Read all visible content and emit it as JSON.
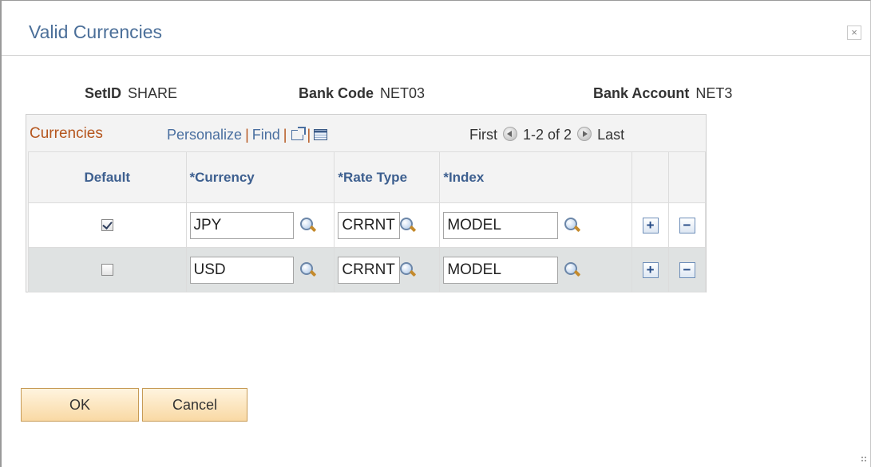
{
  "dialog": {
    "title": "Valid Currencies",
    "close_symbol": "×"
  },
  "header": {
    "setid_label": "SetID",
    "setid_value": "SHARE",
    "bank_code_label": "Bank Code",
    "bank_code_value": "NET03",
    "bank_account_label": "Bank Account",
    "bank_account_value": "NET3"
  },
  "grid": {
    "title": "Currencies",
    "personalize": "Personalize",
    "separator": "|",
    "find": "Find",
    "first": "First",
    "range": "1-2 of 2",
    "last": "Last",
    "columns": {
      "default": "Default",
      "currency": "*Currency",
      "rate_type": "*Rate Type",
      "index": "*Index"
    },
    "rows": [
      {
        "default": true,
        "currency": "JPY",
        "rate_type": "CRRNT",
        "index": "MODEL"
      },
      {
        "default": false,
        "currency": "USD",
        "rate_type": "CRRNT",
        "index": "MODEL"
      }
    ],
    "add_symbol": "+",
    "delete_symbol": "−"
  },
  "buttons": {
    "ok": "OK",
    "cancel": "Cancel"
  },
  "icons": {
    "close": "close-icon",
    "prompt": "lookup-magnifier-icon",
    "new_window": "new-window-icon",
    "download": "spreadsheet-icon",
    "prev": "previous-circle-icon",
    "next": "next-circle-icon"
  },
  "colors": {
    "title": "#4b6f99",
    "grid_title": "#b5561e",
    "link": "#4a6fa0",
    "button_fill": "#f9d9a4",
    "alt_row": "#dfe2e2"
  }
}
